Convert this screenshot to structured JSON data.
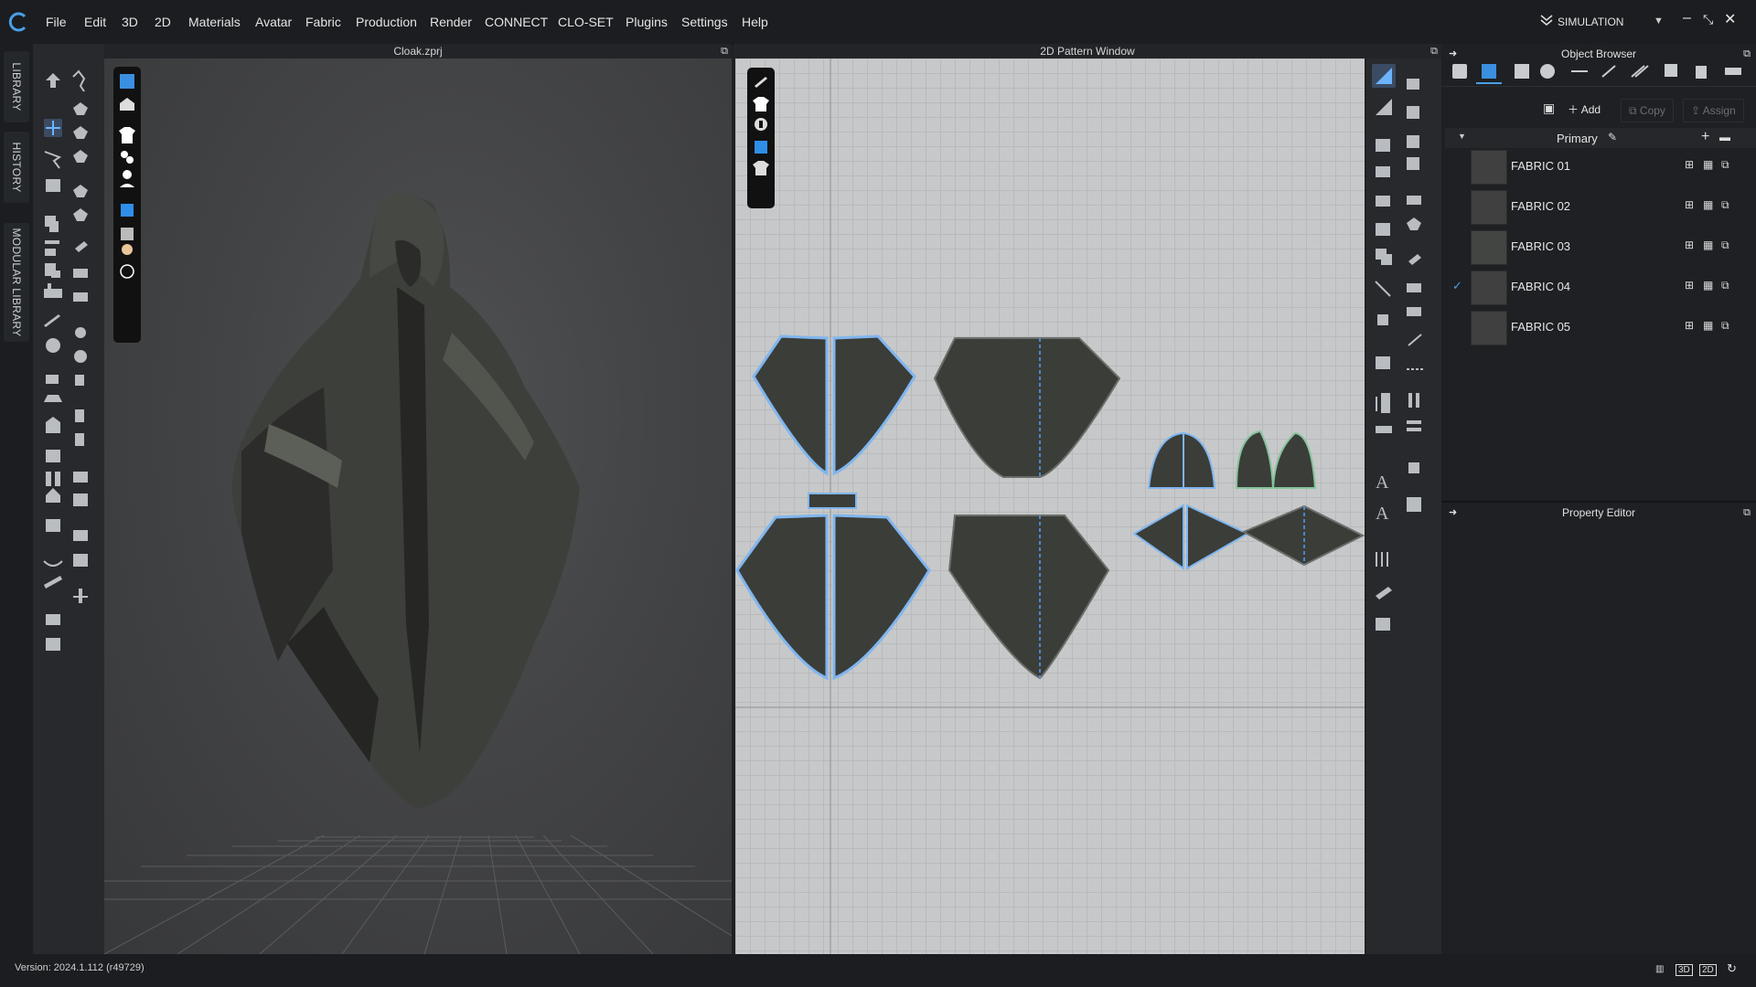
{
  "app": {
    "logo": "clo-logo-icon",
    "menus": [
      "File",
      "Edit",
      "3D",
      "2D",
      "Materials",
      "Avatar",
      "Fabric",
      "Production",
      "Render",
      "CONNECT",
      "CLO-SET",
      "Plugins",
      "Settings",
      "Help"
    ],
    "mode": "SIMULATION",
    "window_buttons": [
      "minimize",
      "restore",
      "close"
    ]
  },
  "side_tabs": [
    "LIBRARY",
    "HISTORY",
    "MODULAR LIBRARY"
  ],
  "viewport3d": {
    "title": "Cloak.zprj"
  },
  "viewport2d": {
    "title": "2D Pattern Window"
  },
  "object_browser": {
    "title": "Object Browser",
    "add_label": "Add",
    "copy_label": "Copy",
    "assign_label": "Assign",
    "group_label": "Primary",
    "fabrics": [
      {
        "name": "FABRIC 01",
        "selected": false,
        "color": "#3e3f3e"
      },
      {
        "name": "FABRIC 02",
        "selected": false,
        "color": "#3a3b3a"
      },
      {
        "name": "FABRIC 03",
        "selected": false,
        "color": "#434543"
      },
      {
        "name": "FABRIC 04",
        "selected": true,
        "color": "#3c3d3c"
      },
      {
        "name": "FABRIC 05",
        "selected": false,
        "color": "#3b3c3b"
      }
    ]
  },
  "property_editor": {
    "title": "Property Editor"
  },
  "status": {
    "version": "Version: 2024.1.112 (r49729)"
  },
  "colors": {
    "accent": "#4a9fe8",
    "background": "#1f2124",
    "pattern_bg": "#c7c8c9",
    "cloth": "#3b3d39"
  }
}
